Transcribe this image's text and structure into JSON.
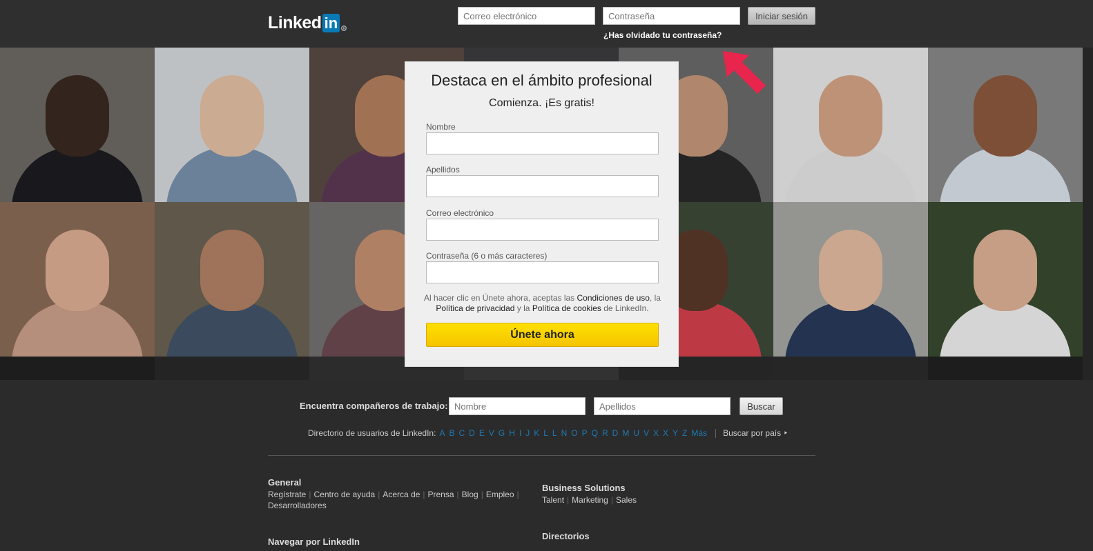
{
  "header": {
    "logo_text": "Linked",
    "logo_in": "in",
    "logo_reg": "®",
    "email_placeholder": "Correo electrónico",
    "password_placeholder": "Contraseña",
    "login_button": "Iniciar sesión",
    "forgot_password": "¿Has olvidado tu contraseña?"
  },
  "signup": {
    "title": "Destaca en el ámbito profesional",
    "subtitle": "Comienza. ¡Es gratis!",
    "first_name_label": "Nombre",
    "last_name_label": "Apellidos",
    "email_label": "Correo electrónico",
    "password_label": "Contraseña (6 o más caracteres)",
    "terms_prefix": "Al hacer clic en Únete ahora, aceptas las ",
    "terms_link": "Condiciones de uso",
    "terms_mid1": ", la ",
    "privacy_link": "Política de privacidad",
    "terms_mid2": " y la ",
    "cookies_link": "Política de cookies",
    "terms_suffix": " de LinkedIn.",
    "join_button": "Únete ahora"
  },
  "find": {
    "label": "Encuentra compañeros de trabajo:",
    "first_placeholder": "Nombre",
    "last_placeholder": "Apellidos",
    "button": "Buscar"
  },
  "directory": {
    "label": "Directorio de usuarios de LinkedIn:",
    "letters": [
      "A",
      "B",
      "C",
      "D",
      "E",
      "V",
      "G",
      "H",
      "I",
      "J",
      "K",
      "L",
      "L",
      "N",
      "O",
      "P",
      "Q",
      "R",
      "D",
      "M",
      "U",
      "V",
      "X",
      "X",
      "Y",
      "Z",
      "Más"
    ],
    "country": "Buscar por país ‣"
  },
  "footer": {
    "general_title": "General",
    "general_links": [
      "Regístrate",
      "Centro de ayuda",
      "Acerca de",
      "Prensa",
      "Blog",
      "Empleo"
    ],
    "general_links_2": [
      "Desarrolladores"
    ],
    "business_title": "Business Solutions",
    "business_links": [
      "Talent",
      "Marketing",
      "Sales"
    ],
    "browse_title": "Navegar por LinkedIn",
    "directories_title": "Directorios"
  },
  "colors": {
    "accent_yellow": "#f5c400",
    "link_blue": "#1f7ab3",
    "arrow_red": "#e8254c"
  },
  "icons": {
    "arrow": "arrow-icon"
  }
}
